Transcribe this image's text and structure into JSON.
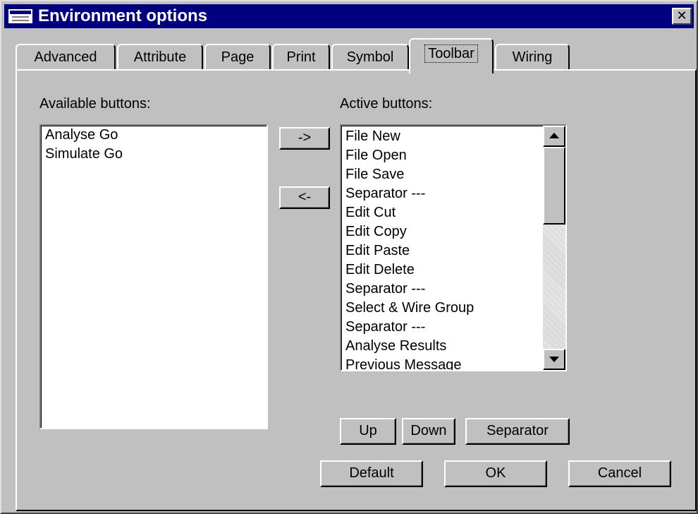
{
  "window": {
    "title": "Environment options",
    "close_glyph": "✕"
  },
  "tabs": [
    {
      "label": "Advanced",
      "active": false
    },
    {
      "label": "Attribute",
      "active": false
    },
    {
      "label": "Page",
      "active": false
    },
    {
      "label": "Print",
      "active": false
    },
    {
      "label": "Symbol",
      "active": false
    },
    {
      "label": "Toolbar",
      "active": true
    },
    {
      "label": "Wiring",
      "active": false
    }
  ],
  "available": {
    "label": "Available buttons:",
    "items": [
      "Analyse Go",
      "Simulate Go"
    ]
  },
  "active": {
    "label": "Active buttons:",
    "items": [
      "File New",
      "File Open",
      "File Save",
      "Separator ---",
      "Edit Cut",
      "Edit Copy",
      "Edit Paste",
      "Edit Delete",
      "Separator ---",
      "Select & Wire Group",
      "Separator ---",
      "Analyse Results",
      "Previous Message"
    ]
  },
  "transfer": {
    "add_label": "->",
    "remove_label": "<-"
  },
  "order_buttons": {
    "up_label": "Up",
    "down_label": "Down",
    "separator_label": "Separator"
  },
  "footer": {
    "default_label": "Default",
    "ok_label": "OK",
    "cancel_label": "Cancel"
  },
  "icons": {
    "title_icon": "window-icon",
    "close_icon": "close-icon",
    "scroll_up": "scroll-up-arrow-icon",
    "scroll_down": "scroll-down-arrow-icon"
  },
  "colors": {
    "title_bar": "#000080",
    "face": "#c0c0c0"
  }
}
